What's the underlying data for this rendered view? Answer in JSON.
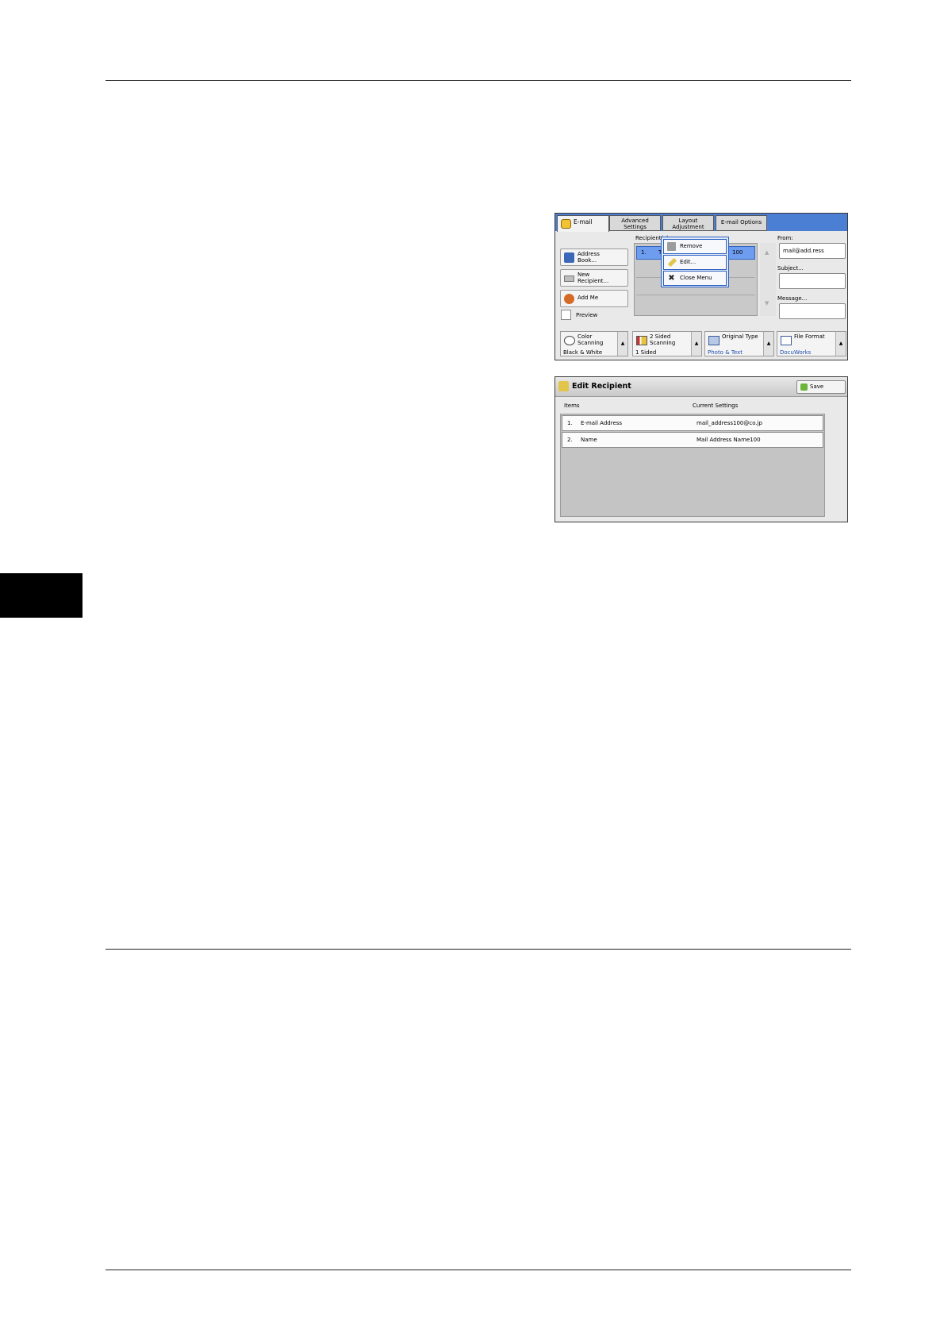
{
  "screen1": {
    "tabs": [
      "E-mail",
      "Advanced\nSettings",
      "Layout\nAdjustment",
      "E-mail Options"
    ],
    "buttons": {
      "address_book": "Address\nBook...",
      "new_recipient": "New\nRecipient...",
      "add_me": "Add Me",
      "preview": "Preview"
    },
    "recipients_label": "Recipient(s)",
    "recipient_row": {
      "num": "1.",
      "text": "T",
      "tail": "100"
    },
    "menu": [
      "Remove",
      "Edit...",
      "Close Menu"
    ],
    "from_label": "From:",
    "from_value": "mail@add.ress",
    "subject_label": "Subject...",
    "message_label": "Message...",
    "features": [
      {
        "title": "Color\nScanning",
        "value": "Black & White"
      },
      {
        "title": "2 Sided\nScanning",
        "value": "1 Sided"
      },
      {
        "title": "Original Type",
        "value": "Photo & Text"
      },
      {
        "title": "File Format",
        "value": "DocuWorks"
      }
    ]
  },
  "screen2": {
    "title": "Edit Recipient",
    "save": "Save",
    "col_items": "Items",
    "col_current": "Current Settings",
    "rows": [
      {
        "num": "1.",
        "item": "E-mail Address",
        "value": "mail_address100@co.jp"
      },
      {
        "num": "2.",
        "item": "Name",
        "value": "Mail Address Name100"
      }
    ]
  }
}
